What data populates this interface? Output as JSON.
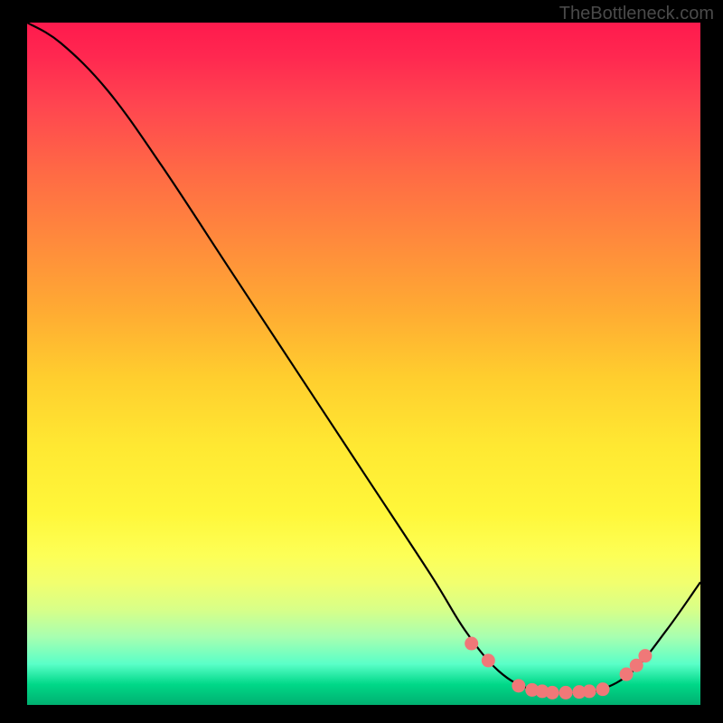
{
  "watermark": "TheBottleneck.com",
  "chart_data": {
    "type": "line",
    "title": "",
    "xlabel": "",
    "ylabel": "",
    "xlim": [
      0,
      100
    ],
    "ylim": [
      0,
      100
    ],
    "curve": {
      "name": "bottleneck-curve",
      "points": [
        {
          "x": 0,
          "y": 100
        },
        {
          "x": 5,
          "y": 97
        },
        {
          "x": 12,
          "y": 90
        },
        {
          "x": 20,
          "y": 79
        },
        {
          "x": 30,
          "y": 64
        },
        {
          "x": 40,
          "y": 49
        },
        {
          "x": 50,
          "y": 34
        },
        {
          "x": 60,
          "y": 19
        },
        {
          "x": 65,
          "y": 11
        },
        {
          "x": 70,
          "y": 5
        },
        {
          "x": 75,
          "y": 2.2
        },
        {
          "x": 80,
          "y": 1.8
        },
        {
          "x": 85,
          "y": 2.2
        },
        {
          "x": 90,
          "y": 5
        },
        {
          "x": 95,
          "y": 11
        },
        {
          "x": 100,
          "y": 18
        }
      ]
    },
    "markers": {
      "name": "highlight-points",
      "color": "#f07878",
      "points": [
        {
          "x": 66,
          "y": 9
        },
        {
          "x": 68.5,
          "y": 6.5
        },
        {
          "x": 73,
          "y": 2.8
        },
        {
          "x": 75,
          "y": 2.2
        },
        {
          "x": 76.5,
          "y": 2.0
        },
        {
          "x": 78,
          "y": 1.8
        },
        {
          "x": 80,
          "y": 1.8
        },
        {
          "x": 82,
          "y": 1.9
        },
        {
          "x": 83.5,
          "y": 2.0
        },
        {
          "x": 85.5,
          "y": 2.3
        },
        {
          "x": 89,
          "y": 4.5
        },
        {
          "x": 90.5,
          "y": 5.8
        },
        {
          "x": 91.8,
          "y": 7.2
        }
      ]
    }
  }
}
